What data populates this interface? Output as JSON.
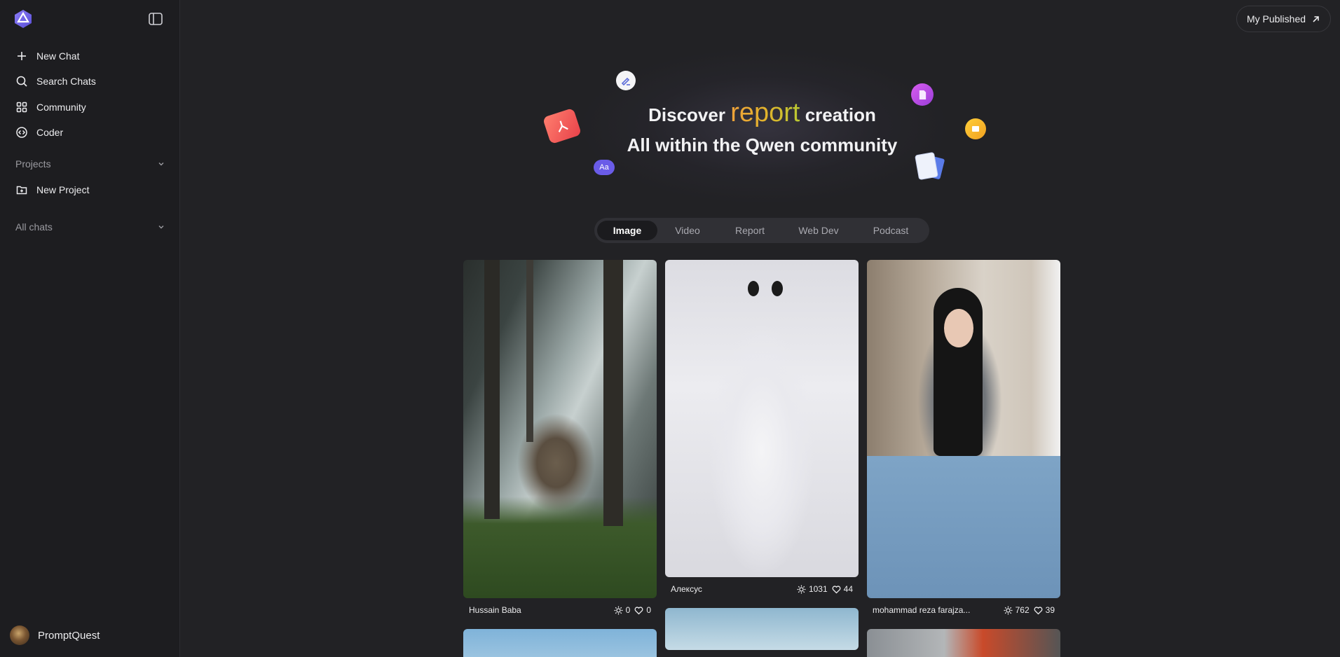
{
  "sidebar": {
    "logo_icon": "qwen-logo-icon",
    "nav": [
      {
        "label": "New Chat",
        "icon": "plus-icon"
      },
      {
        "label": "Search Chats",
        "icon": "search-icon"
      },
      {
        "label": "Community",
        "icon": "grid-icon"
      },
      {
        "label": "Coder",
        "icon": "code-icon"
      }
    ],
    "projects_label": "Projects",
    "new_project_label": "New Project",
    "all_chats_label": "All chats",
    "user_name": "PromptQuest"
  },
  "header": {
    "my_published_label": "My Published"
  },
  "hero": {
    "line1_prefix": "Discover",
    "line1_accent": "report",
    "line1_suffix": "creation",
    "line2": "All within the Qwen community"
  },
  "tabs": [
    "Image",
    "Video",
    "Report",
    "Web Dev",
    "Podcast"
  ],
  "active_tab": "Image",
  "cards": [
    {
      "author": "Hussain Baba",
      "views": "0",
      "likes": "0"
    },
    {
      "author": "Алексус",
      "views": "1031",
      "likes": "44"
    },
    {
      "author": "mohammad reza farajza...",
      "views": "762",
      "likes": "39"
    }
  ],
  "colors": {
    "accent_gradient_start": "#f0a23a",
    "accent_gradient_end": "#b9c832",
    "background": "#222225",
    "sidebar": "#1d1d20"
  }
}
